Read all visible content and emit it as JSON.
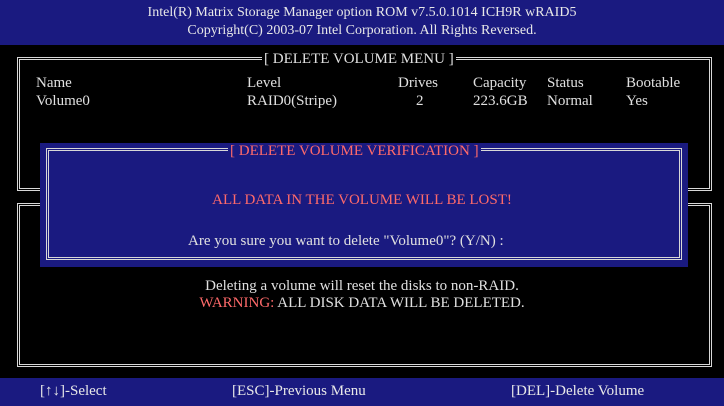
{
  "header": {
    "line1": "Intel(R) Matrix Storage Manager option ROM v7.5.0.1014 ICH9R wRAID5",
    "line2": "Copyright(C) 2003-07 Intel Corporation.  All Rights Reversed."
  },
  "main_panel": {
    "title": "[ DELETE VOLUME MENU ]",
    "columns": [
      "Name",
      "Level",
      "Drives",
      "Capacity",
      "Status",
      "Bootable"
    ],
    "rows": [
      [
        "Volume0",
        "RAID0(Stripe)",
        "2",
        "223.6GB",
        "Normal",
        "Yes"
      ]
    ]
  },
  "dialog": {
    "title": "[ DELETE VOLUME VERIFICATION ]",
    "warning": "ALL DATA IN THE VOLUME WILL BE LOST!",
    "prompt": "Are you sure you want to delete \"Volume0\"? (Y/N) :"
  },
  "info_panel": {
    "line1": "Deleting a volume will reset the disks to non-RAID.",
    "warning_label": "WARNING:",
    "warning_text": " ALL DISK DATA WILL BE DELETED."
  },
  "footer": {
    "select": "[↑↓]-Select",
    "previous": "[ESC]-Previous Menu",
    "delete": "[DEL]-Delete Volume"
  },
  "colors": {
    "header_bg": "#1a1a80",
    "text": "#e0e0e0",
    "warning": "#ff6a6a"
  }
}
